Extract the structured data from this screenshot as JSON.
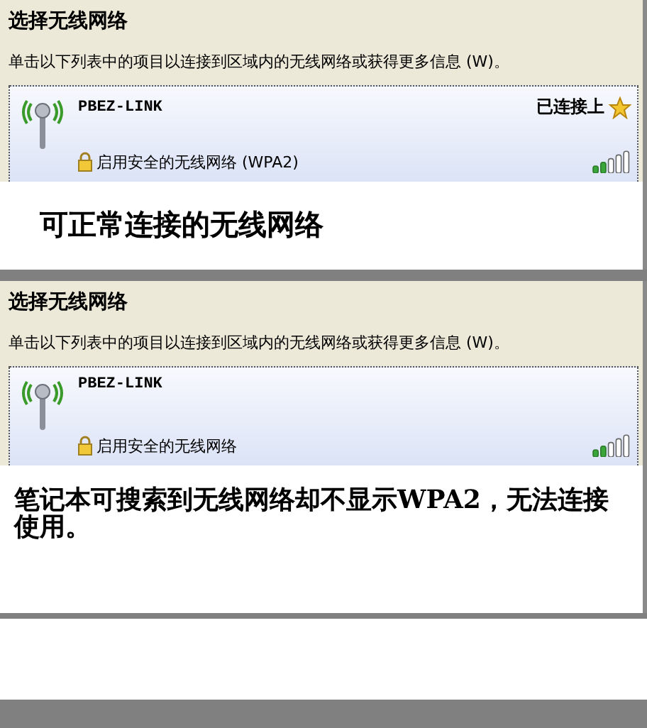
{
  "panels": [
    {
      "title": "选择无线网络",
      "instruction": "单击以下列表中的项目以连接到区域内的无线网络或获得更多信息 (W)。",
      "network": {
        "name": "PBEZ-LINK",
        "status": "已连接上",
        "security": "启用安全的无线网络 (WPA2)"
      },
      "caption": "可正常连接的无线网络"
    },
    {
      "title": "选择无线网络",
      "instruction": "单击以下列表中的项目以连接到区域内的无线网络或获得更多信息 (W)。",
      "network": {
        "name": "PBEZ-LINK",
        "security": "启用安全的无线网络"
      },
      "caption": "笔记本可搜索到无线网络却不显示WPA2，无法连接使用。"
    }
  ]
}
